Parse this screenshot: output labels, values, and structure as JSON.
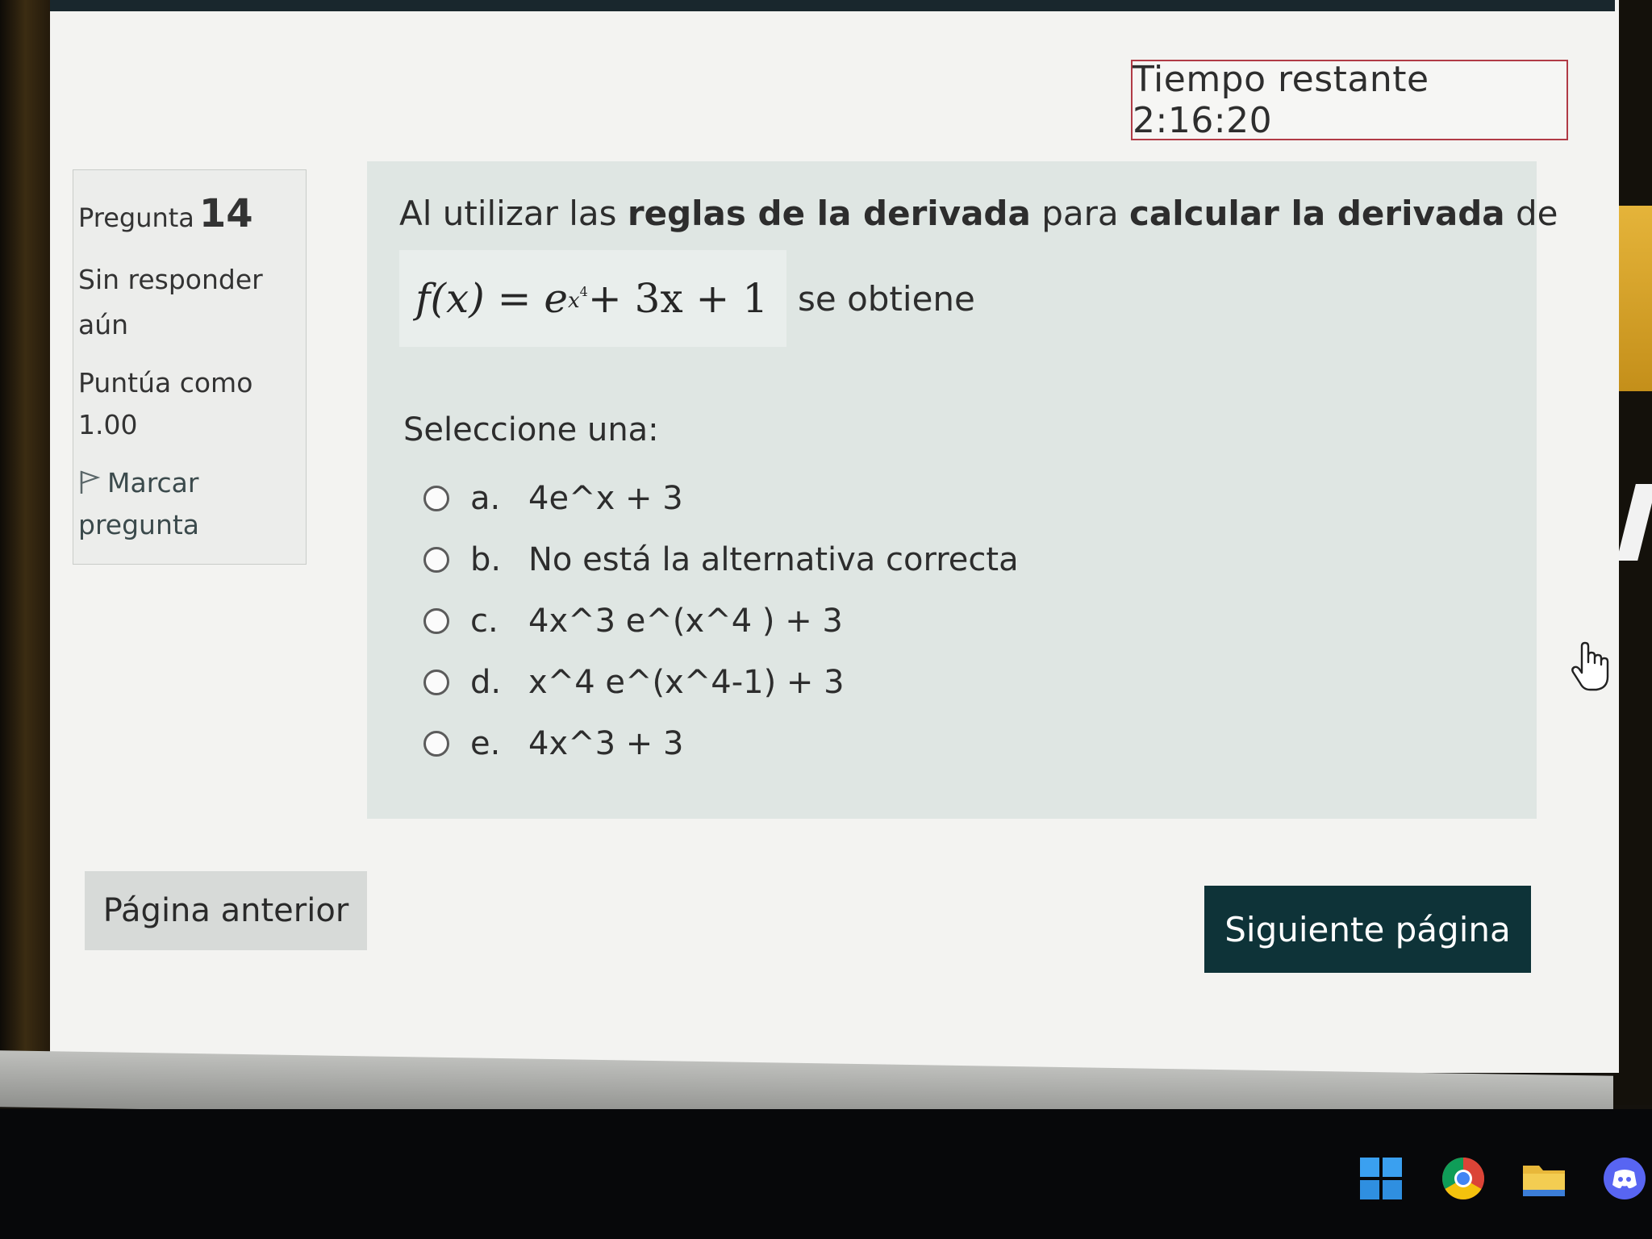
{
  "timer": {
    "label": "Tiempo restante 2:16:20"
  },
  "info": {
    "question_word": "Pregunta",
    "question_number": "14",
    "state_line1": "Sin responder",
    "state_line2": "aún",
    "mark_line1": "Puntúa como",
    "mark_line2": "1.00",
    "flag_line1": "Marcar",
    "flag_line2": "pregunta"
  },
  "question": {
    "text_1": "Al utilizar las ",
    "bold_1": "reglas de la derivada",
    "text_2": " para ",
    "bold_2": "calcular la derivada",
    "text_3": " de",
    "formula": {
      "lhs": "f(x) = e",
      "exp_base": "x",
      "exp_power": "4",
      "rhs": " + 3x + 1"
    },
    "suffix": "se obtiene",
    "select_label": "Seleccione una:",
    "options": [
      {
        "letter": "a.",
        "text": "4e^x + 3"
      },
      {
        "letter": "b.",
        "text": "No está la alternativa correcta"
      },
      {
        "letter": "c.",
        "text": "4x^3 e^(x^4 ) + 3"
      },
      {
        "letter": "d.",
        "text": "x^4 e^(x^4-1) + 3"
      },
      {
        "letter": "e.",
        "text": "4x^3 + 3"
      }
    ]
  },
  "nav": {
    "prev_label": "Página anterior",
    "next_label": "Siguiente página"
  },
  "taskbar": {
    "icons": [
      "windows-start-icon",
      "chrome-icon",
      "file-explorer-icon",
      "discord-icon"
    ]
  },
  "colors": {
    "timer_border": "#b13b46",
    "next_button": "#0e3338",
    "question_bg": "#dfe6e3",
    "info_bg": "#ecedeb"
  }
}
